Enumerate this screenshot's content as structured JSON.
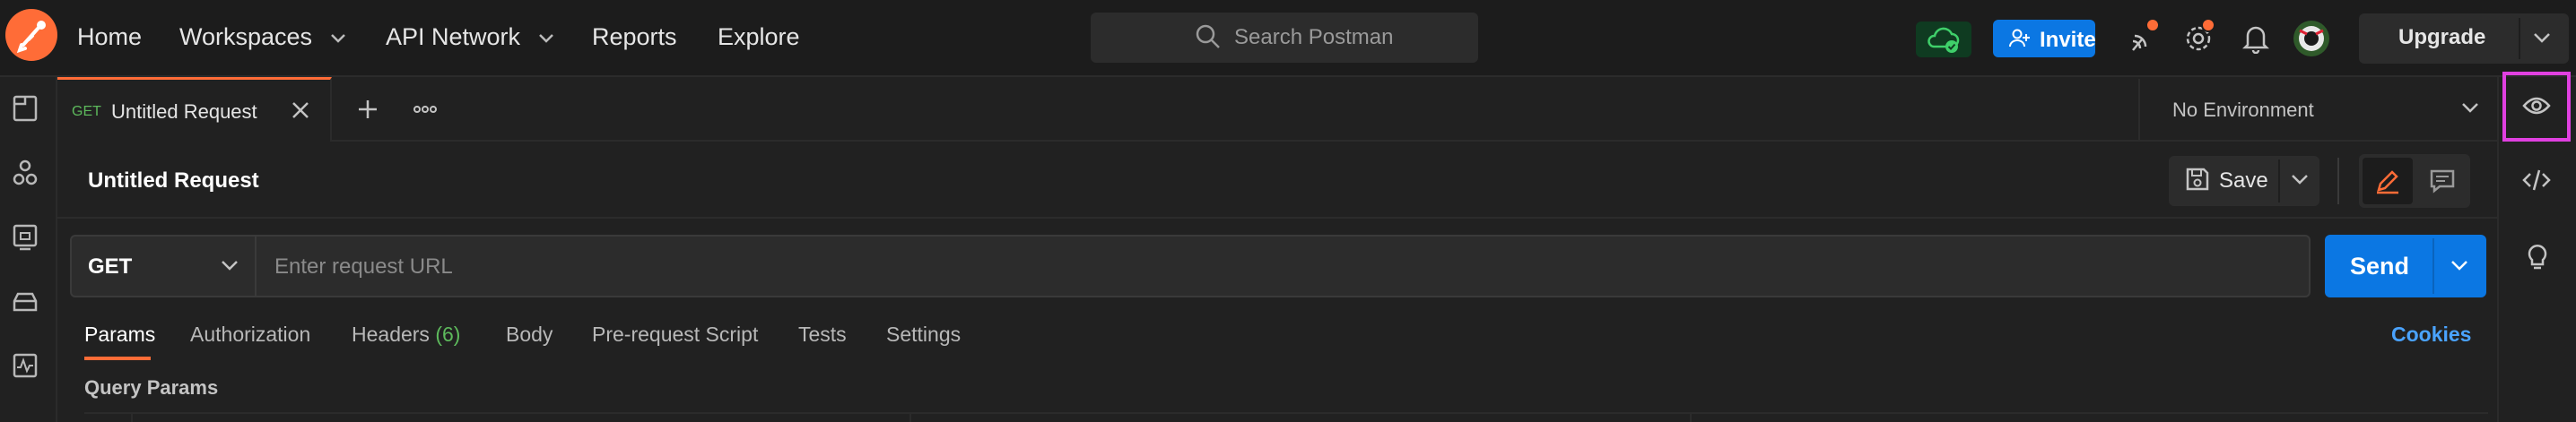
{
  "topbar": {
    "nav": [
      "Home",
      "Workspaces",
      "API Network",
      "Reports",
      "Explore"
    ],
    "search_placeholder": "Search Postman",
    "invite_label": "Invite",
    "upgrade_label": "Upgrade"
  },
  "tab": {
    "method": "GET",
    "title": "Untitled Request"
  },
  "environment": {
    "selected": "No Environment"
  },
  "request": {
    "title": "Untitled Request",
    "save_label": "Save",
    "method": "GET",
    "url_placeholder": "Enter request URL",
    "send_label": "Send"
  },
  "subtabs": {
    "params": "Params",
    "authorization": "Authorization",
    "headers": "Headers",
    "headers_count": "(6)",
    "body": "Body",
    "prerequest": "Pre-request Script",
    "tests": "Tests",
    "settings": "Settings",
    "cookies": "Cookies"
  },
  "query_params": {
    "title": "Query Params"
  },
  "colors": {
    "accent": "#ff6c37",
    "primary": "#0b77e3",
    "get_method": "#5db95c",
    "link": "#4aa3ff"
  }
}
